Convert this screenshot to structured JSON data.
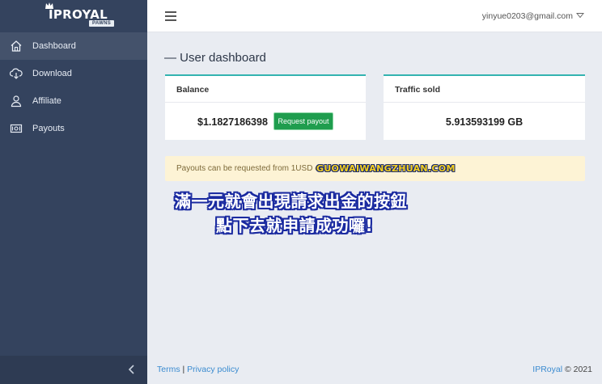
{
  "brand": {
    "name": "IPROYAL",
    "badge": "PAWNS"
  },
  "sidebar": {
    "items": [
      {
        "label": "Dashboard",
        "icon": "home-icon"
      },
      {
        "label": "Download",
        "icon": "cloud-download-icon"
      },
      {
        "label": "Affiliate",
        "icon": "user-icon"
      },
      {
        "label": "Payouts",
        "icon": "money-icon"
      }
    ],
    "active": "Dashboard",
    "collapse_icon": "chevron-left-icon"
  },
  "topbar": {
    "user_email": "yinyue0203@gmail.com"
  },
  "main": {
    "title": "User dashboard",
    "balance": {
      "header": "Balance",
      "value": "$1.1827186398",
      "button": "Request payout"
    },
    "traffic": {
      "header": "Traffic sold",
      "value": "5.913593199 GB"
    },
    "alert": "Payouts can be requested from 1USD ea"
  },
  "overlay": {
    "watermark": "GUOWAIWANGZHUAN.COM",
    "line1": "滿一元就會出現請求出金的按鈕",
    "line2": "點下去就申請成功囉!"
  },
  "footer": {
    "terms": "Terms",
    "separator": "|",
    "privacy": "Privacy policy",
    "brand": "IPRoyal",
    "copyright": "© 2021"
  },
  "colors": {
    "sidebar": "#34435e",
    "accent": "#33b3b0",
    "button": "#1f9d4e",
    "alert_bg": "#fdf3d5"
  }
}
